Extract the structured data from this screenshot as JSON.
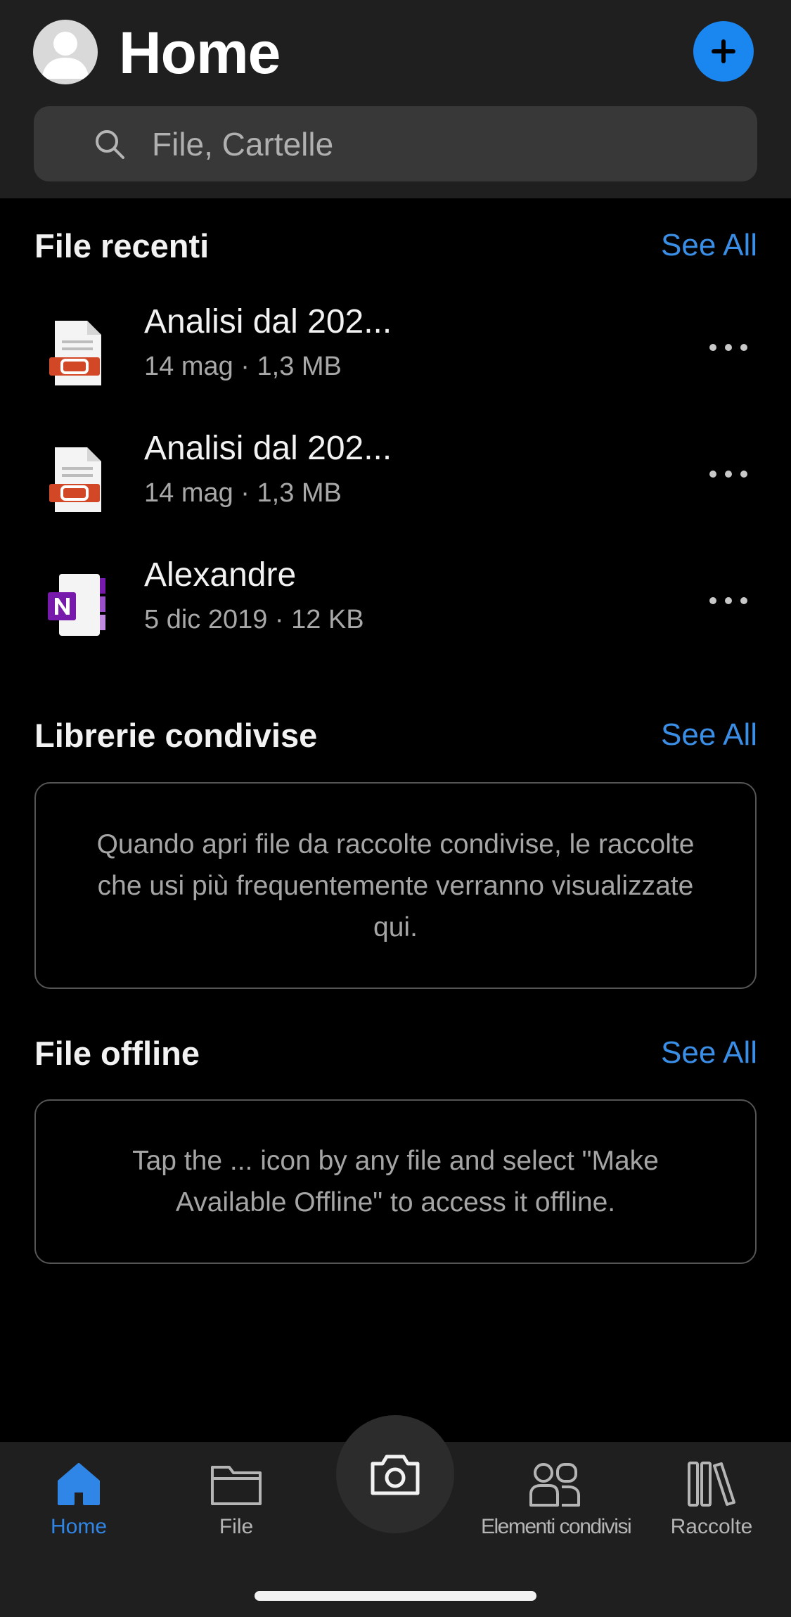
{
  "header": {
    "title": "Home",
    "avatar_icon": "person-icon",
    "add_icon": "plus-icon",
    "accent_color": "#1a86f0"
  },
  "search": {
    "placeholder": "File, Cartelle",
    "icon": "search-icon"
  },
  "recent": {
    "title": "File recenti",
    "see_all": "See All",
    "items": [
      {
        "name": "Analisi dal 202...",
        "meta": "14 mag · 1,3 MB",
        "type": "pdf",
        "icon": "pdf-file-icon"
      },
      {
        "name": "Analisi dal 202...",
        "meta": "14 mag · 1,3 MB",
        "type": "pdf",
        "icon": "pdf-file-icon"
      },
      {
        "name": "Alexandre",
        "meta": "5 dic 2019 · 12 KB",
        "type": "onenote",
        "icon": "onenote-file-icon"
      }
    ]
  },
  "shared_libraries": {
    "title": "Librerie condivise",
    "see_all": "See All",
    "empty_text": "Quando apri file da raccolte condivise, le raccolte che usi più frequentemente verranno visualizzate qui."
  },
  "offline": {
    "title": "File offline",
    "see_all": "See All",
    "empty_text": "Tap the ... icon by any file and select \"Make Available Offline\" to access it offline."
  },
  "tabbar": {
    "tabs": [
      {
        "label": "Home",
        "icon": "home-icon",
        "active": true
      },
      {
        "label": "File",
        "icon": "folder-icon",
        "active": false
      },
      {
        "label": "Elementi condivisi",
        "icon": "shared-people-icon",
        "active": false
      },
      {
        "label": "Raccolte",
        "icon": "library-icon",
        "active": false
      }
    ],
    "camera_icon": "camera-icon"
  },
  "colors": {
    "link": "#3a8ee6",
    "active_tab": "#2f86e6",
    "pdf_red": "#d24726",
    "onenote_purple": "#7719aa"
  }
}
